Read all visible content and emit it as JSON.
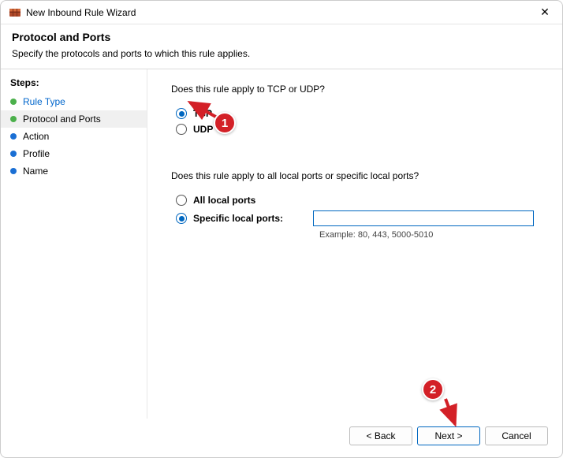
{
  "window": {
    "title": "New Inbound Rule Wizard"
  },
  "header": {
    "title": "Protocol and Ports",
    "description": "Specify the protocols and ports to which this rule applies."
  },
  "sidebar": {
    "label": "Steps:",
    "steps": [
      {
        "label": "Rule Type"
      },
      {
        "label": "Protocol and Ports"
      },
      {
        "label": "Action"
      },
      {
        "label": "Profile"
      },
      {
        "label": "Name"
      }
    ]
  },
  "content": {
    "q1": "Does this rule apply to TCP or UDP?",
    "tcp_label": "TCP",
    "udp_label": "UDP",
    "q2": "Does this rule apply to all local ports or specific local ports?",
    "all_ports_label": "All local ports",
    "specific_ports_label": "Specific local ports:",
    "ports_value": "",
    "example": "Example: 80, 443, 5000-5010"
  },
  "buttons": {
    "back": "< Back",
    "next": "Next >",
    "cancel": "Cancel"
  },
  "annotations": {
    "badge1": "1",
    "badge2": "2"
  }
}
